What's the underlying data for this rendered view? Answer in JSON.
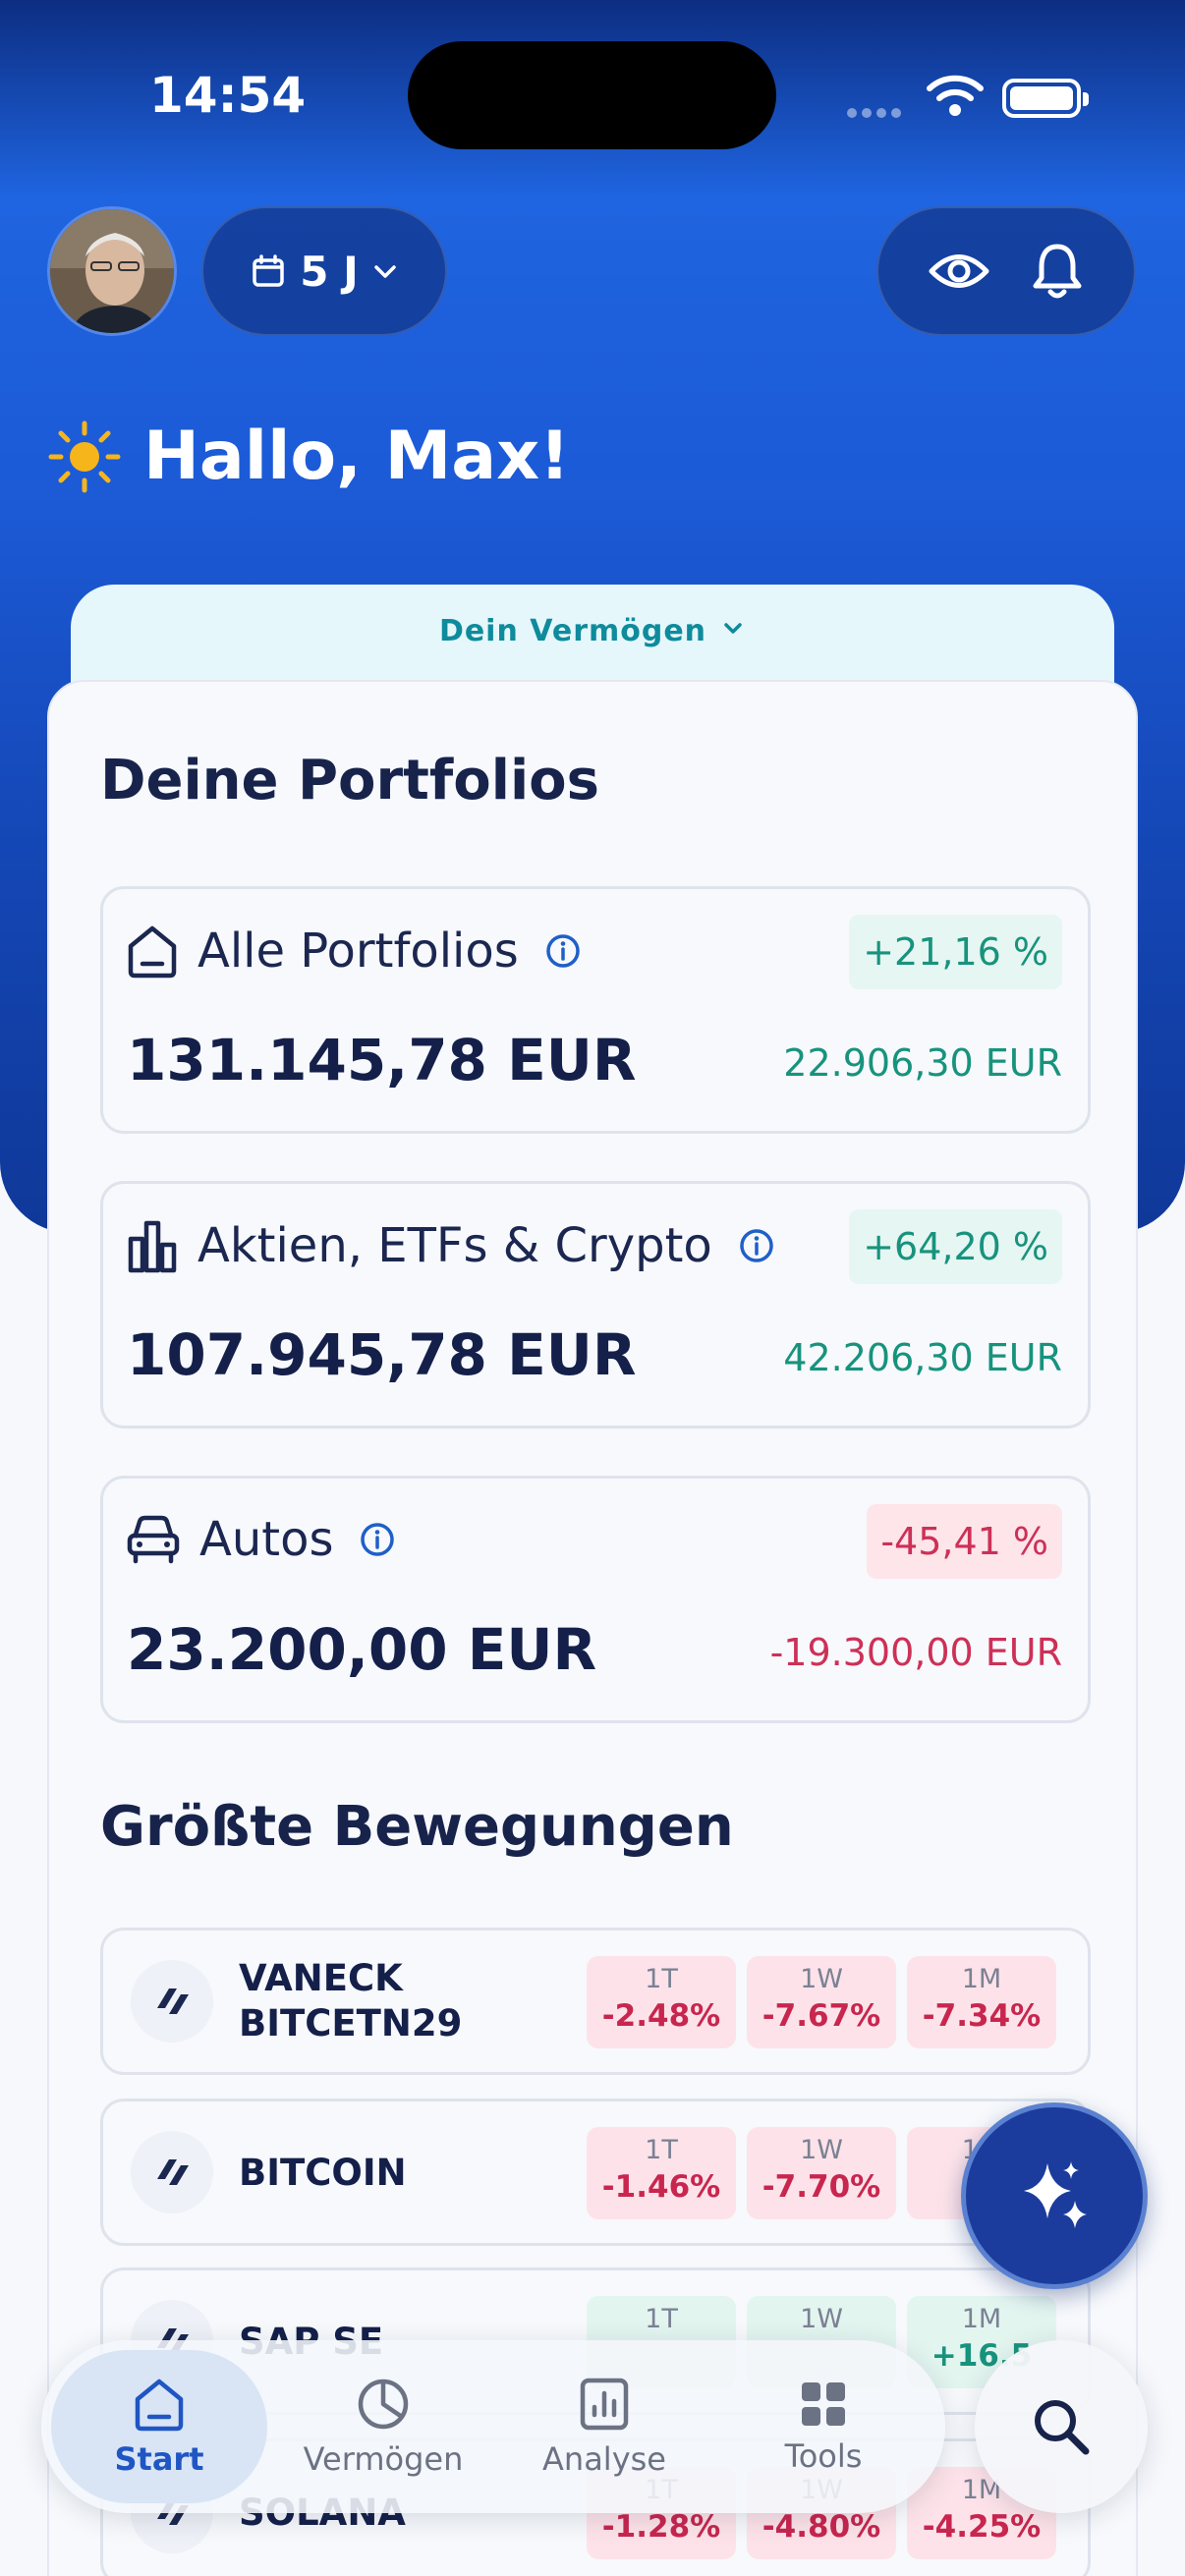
{
  "status_bar": {
    "time": "14:54"
  },
  "header": {
    "period_label": "5 J"
  },
  "greeting": {
    "text": "Hallo, Max!"
  },
  "vermoegen_tab": {
    "label": "Dein Vermögen"
  },
  "portfolios_section": {
    "title": "Deine Portfolios",
    "items": [
      {
        "name": "Alle Portfolios",
        "percent": "+21,16 %",
        "value": "131.145,78 EUR",
        "delta": "22.906,30 EUR",
        "trend": "positive",
        "icon": "home-icon"
      },
      {
        "name": "Aktien, ETFs & Crypto",
        "percent": "+64,20 %",
        "value": "107.945,78 EUR",
        "delta": "42.206,30 EUR",
        "trend": "positive",
        "icon": "bar-chart-icon"
      },
      {
        "name": "Autos",
        "percent": "-45,41 %",
        "value": "23.200,00 EUR",
        "delta": "-19.300,00 EUR",
        "trend": "negative",
        "icon": "car-icon"
      }
    ]
  },
  "movements_section": {
    "title": "Größte Bewegungen",
    "rows": [
      {
        "name_line1": "VANECK",
        "name_line2": "BITCETN29",
        "chips": [
          {
            "label": "1T",
            "value": "-2.48%"
          },
          {
            "label": "1W",
            "value": "-7.67%"
          },
          {
            "label": "1M",
            "value": "-7.34%"
          }
        ]
      },
      {
        "name_line1": "BITCOIN",
        "name_line2": "",
        "chips": [
          {
            "label": "1T",
            "value": "-1.46%"
          },
          {
            "label": "1W",
            "value": "-7.70%"
          },
          {
            "label": "1M",
            "value": "-9"
          }
        ]
      },
      {
        "name_line1": "SAP SE",
        "name_line2": "",
        "chips": [
          {
            "label": "1T",
            "value": ""
          },
          {
            "label": "1W",
            "value": ""
          },
          {
            "label": "1M",
            "value": "+16.5"
          }
        ]
      },
      {
        "name_line1": "SOLANA",
        "name_line2": "",
        "chips": [
          {
            "label": "1T",
            "value": "-1.28%"
          },
          {
            "label": "1W",
            "value": "-4.80%"
          },
          {
            "label": "1M",
            "value": "-4.25%"
          }
        ]
      }
    ]
  },
  "bottom_nav": {
    "items": [
      {
        "label": "Start",
        "icon": "home-icon",
        "active": true
      },
      {
        "label": "Vermögen",
        "icon": "pie-chart-icon",
        "active": false
      },
      {
        "label": "Analyse",
        "icon": "analytics-icon",
        "active": false
      },
      {
        "label": "Tools",
        "icon": "grid-icon",
        "active": false
      }
    ]
  },
  "colors": {
    "accent": "#1f56c3",
    "positive": "#17937d",
    "negative": "#cd3057",
    "hero": "#1c5ad6"
  }
}
